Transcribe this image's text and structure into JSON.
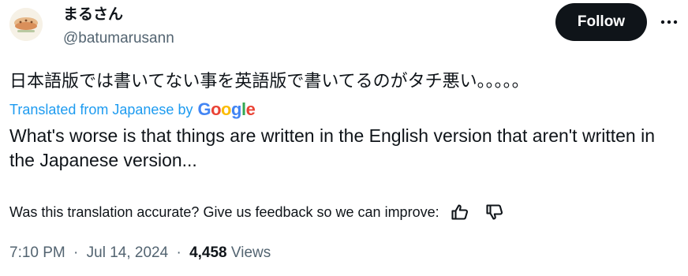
{
  "author": {
    "display_name": "まるさん",
    "handle": "@batumarusann"
  },
  "actions": {
    "follow_label": "Follow",
    "more_icon": "more-horizontal-icon"
  },
  "tweet": {
    "original_text": "日本語版では書いてない事を英語版で書いてるのがタチ悪い。。。。。",
    "translated_by_label": "Translated from Japanese by",
    "translation_provider": "Google",
    "translated_text": "What's worse is that things are written in the English version that aren't written in the Japanese version..."
  },
  "feedback": {
    "prompt": "Was this translation accurate? Give us feedback so we can improve:",
    "thumbs_up_icon": "thumbs-up-icon",
    "thumbs_down_icon": "thumbs-down-icon"
  },
  "meta": {
    "time": "7:10 PM",
    "separator": "·",
    "date": "Jul 14, 2024",
    "views_count": "4,458",
    "views_label": "Views"
  },
  "colors": {
    "link": "#1d9bf0",
    "primary_text": "#0f1419",
    "secondary_text": "#536471",
    "follow_button_bg": "#0f1419",
    "google_blue": "#4285F4",
    "google_red": "#EA4335",
    "google_yellow": "#FBBC05",
    "google_green": "#34A853"
  }
}
